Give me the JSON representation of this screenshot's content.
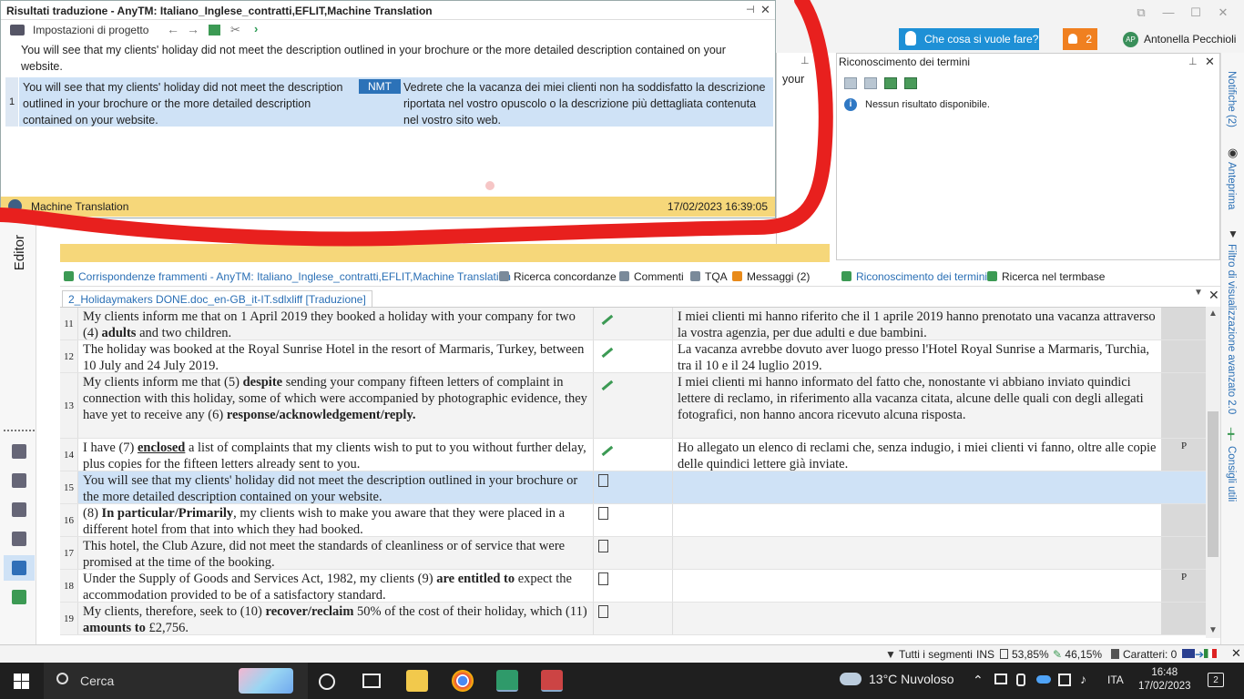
{
  "topbar": {
    "help_label": "Che cosa si vuole fare?",
    "notif_count": "2",
    "user_initials": "AP",
    "user_name": "Antonella Pecchioli",
    "window_controls": [
      "⧉",
      "—",
      "☐",
      "✕"
    ]
  },
  "results_panel": {
    "title": "Risultati traduzione - AnyTM: Italiano_Inglese_contratti,EFLIT,Machine Translation",
    "settings_label": "Impostazioni di progetto",
    "source_text": "You will see that my clients' holiday did not meet the description outlined in your brochure or the more detailed description contained on your website.",
    "row_number": "1",
    "row_source": "You will see that my clients' holiday did not meet the description outlined in your brochure or the more detailed description contained on your website.",
    "row_tag": "NMT",
    "row_target": "Vedrete che la vacanza dei miei clienti non ha soddisfatto la descrizione riportata nel vostro opuscolo o la descrizione più dettagliata contenuta nel vostro sito web.",
    "footer_label": "Machine Translation",
    "footer_date": "17/02/2023 16:39:05"
  },
  "behind_fragment": "your",
  "term_panel": {
    "title": "Riconoscimento dei termini",
    "no_results": "Nessun risultato disponibile."
  },
  "right_sidebar": {
    "tabs": [
      "Notifiche (2)",
      "Anteprima",
      "Filtro di visualizzazione avanzato 2.0",
      "Consigli utili"
    ]
  },
  "bottom_tabs": {
    "fragments": "Corrispondenze frammenti - AnyTM: Italiano_Inglese_contratti,EFLIT,Machine Translation",
    "concordance": "Ricerca concordanze",
    "comments": "Commenti",
    "tqa": "TQA",
    "messages": "Messaggi (2)",
    "term_recognition": "Riconoscimento dei termini",
    "termbase_search": "Ricerca nel termbase"
  },
  "left_sidebar": {
    "editor_label": "Editor"
  },
  "document_tab": "2_Holidaymakers DONE.doc_en-GB_it-IT.sdlxliff [Traduzione]",
  "segments": [
    {
      "n": "11",
      "source_html": "My clients inform me that on 1 April 2019 they booked a holiday with your company for two (4) <b>adults</b> and two children.",
      "status": "pen",
      "target": "I miei clienti mi hanno riferito che il 1 aprile 2019 hanno prenotato una vacanza attraverso la vostra agenzia, per due adulti e due bambini.",
      "mark": ""
    },
    {
      "n": "12",
      "source_html": "The holiday was booked at the Royal Sunrise Hotel in the resort of Marmaris, Turkey, between 10 July and 24 July 2019.",
      "status": "pen",
      "target": "La vacanza avrebbe dovuto aver luogo presso l'Hotel Royal Sunrise a Marmaris, Turchia, tra il 10 e il 24 luglio 2019.",
      "mark": ""
    },
    {
      "n": "13",
      "source_html": "My clients inform me that (5) <b>despite</b> sending your company fifteen letters of complaint in connection with this holiday, some of which were accompanied by photographic evidence, they have yet to receive any (6) <b>response/acknowledgement/reply.</b>",
      "status": "pen",
      "target": "I miei clienti mi hanno informato del fatto che, nonostante vi abbiano inviato quindici lettere di reclamo, in riferimento alla vacanza citata, alcune delle quali con degli allegati fotografici, non hanno ancora ricevuto alcuna risposta.",
      "mark": ""
    },
    {
      "n": "14",
      "source_html": "I have (7) <b><u>enclosed</u></b> a list of complaints that my clients wish to put to you without further delay, plus copies for the fifteen letters already sent to you.",
      "status": "pen",
      "target": "Ho allegato un elenco di reclami che, senza indugio, i miei clienti vi fanno, oltre alle copie delle quindici lettere già inviate.",
      "mark": "P"
    },
    {
      "n": "15",
      "source_html": "You will see that my clients' holiday did not meet the description outlined in your brochure or the more detailed description contained on your website.",
      "status": "doc",
      "target": "",
      "mark": ""
    },
    {
      "n": "16",
      "source_html": "(8) <b>In particular/Primarily</b>, my clients wish to make you aware that they were placed in a different hotel from that into which they had booked.",
      "status": "doc",
      "target": "",
      "mark": ""
    },
    {
      "n": "17",
      "source_html": "This hotel, the Club Azure, did not meet the standards of cleanliness or of service that were promised at the time of the booking.",
      "status": "doc",
      "target": "",
      "mark": ""
    },
    {
      "n": "18",
      "source_html": "Under the Supply of Goods and Services Act, 1982, my clients (9) <b>are entitled to</b> expect the accommodation provided to be of a satisfactory standard.",
      "status": "doc",
      "target": "",
      "mark": "P"
    },
    {
      "n": "19",
      "source_html": "My clients, therefore, seek to (10) <b>recover/reclaim</b> 50% of the cost of their holiday, which (11) <b>amounts to</b> £2,756.",
      "status": "doc",
      "target": "",
      "mark": ""
    }
  ],
  "status_bar": {
    "filter": "Tutti i segmenti",
    "mode": "INS",
    "pct1": "53,85%",
    "pct2": "46,15%",
    "chars": "Caratteri: 0"
  },
  "taskbar": {
    "search": "Cerca",
    "weather": "13°C  Nuvoloso",
    "lang": "ITA",
    "time": "16:48",
    "date": "17/02/2023",
    "notif": "2"
  }
}
